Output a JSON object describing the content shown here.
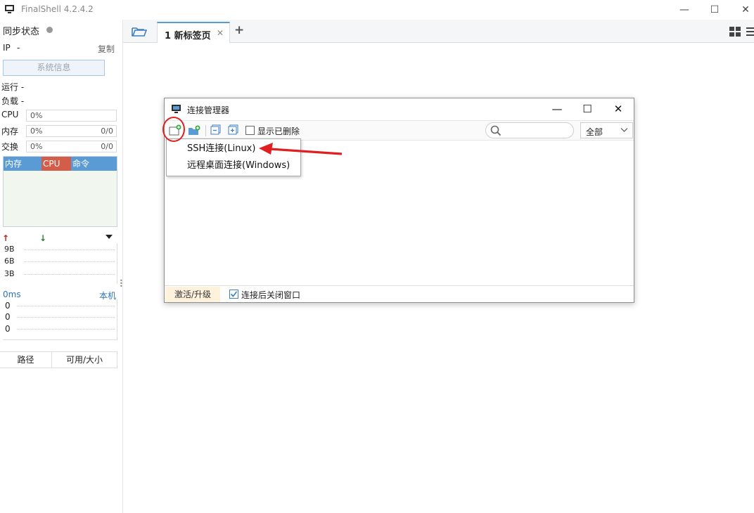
{
  "app": {
    "title": "FinalShell 4.2.4.2"
  },
  "window_controls": {
    "minimize": "—",
    "maximize": "☐",
    "close": "✕"
  },
  "sidebar": {
    "sync_status": "同步状态",
    "ip_label": "IP",
    "ip_value": "-",
    "copy": "复制",
    "sysinfo_button": "系统信息",
    "run": "运行 -",
    "load": "负载 -",
    "meters": [
      {
        "label": "CPU",
        "percent": "0%",
        "fraction": ""
      },
      {
        "label": "内存",
        "percent": "0%",
        "fraction": "0/0"
      },
      {
        "label": "交换",
        "percent": "0%",
        "fraction": "0/0"
      }
    ],
    "process_headers": {
      "mem": "内存",
      "cpu": "CPU",
      "cmd": "命令"
    },
    "net_up": "↑",
    "net_down": "↓",
    "net_ticks": [
      "9B",
      "6B",
      "3B"
    ],
    "ping_ms": "0ms",
    "ping_local": "本机",
    "ping_ticks": [
      "0",
      "0",
      "0"
    ],
    "disk_headers": {
      "path": "路径",
      "size": "可用/大小"
    }
  },
  "tabs": {
    "items": [
      {
        "label": "1 新标签页",
        "close": "✕"
      }
    ],
    "add": "+"
  },
  "dialog": {
    "title": "连接管理器",
    "controls": {
      "minimize": "—",
      "maximize": "☐",
      "close": "✕"
    },
    "show_deleted_label": "显示已删除",
    "show_deleted_checked": false,
    "search_placeholder": "",
    "filter_value": "全部",
    "activate_button": "激活/升级",
    "close_after_connect_label": "连接后关闭窗口",
    "close_after_connect_checked": true
  },
  "new_menu": {
    "items": [
      "SSH连接(Linux)",
      "远程桌面连接(Windows)"
    ]
  },
  "colors": {
    "accent": "#5b9bd5",
    "cpu_header": "#d45d4a",
    "annotation": "#e02020"
  }
}
